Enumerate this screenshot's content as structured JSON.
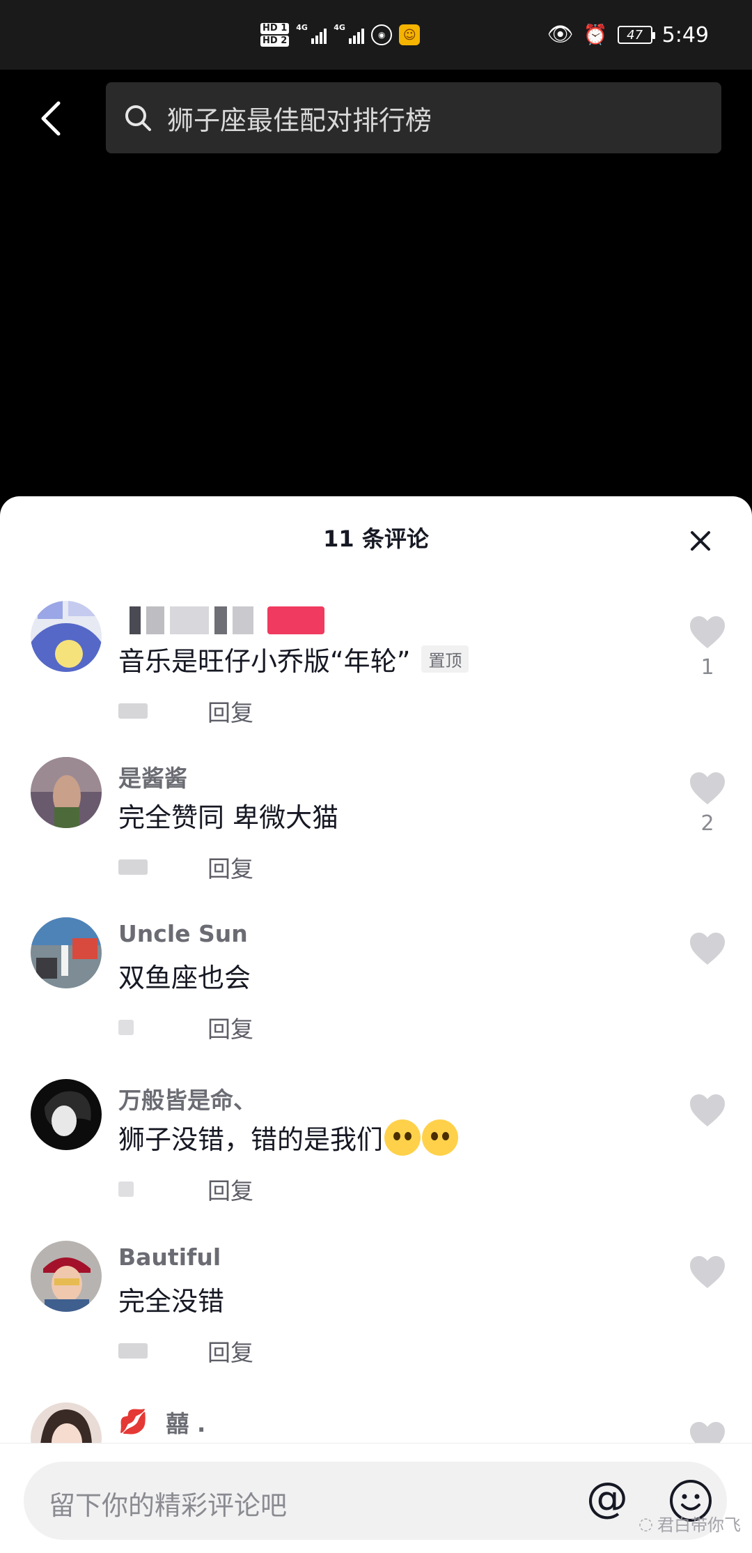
{
  "status_bar": {
    "hd1": "HD 1",
    "hd2": "HD 2",
    "net1": "4G",
    "net2": "4G",
    "battery": "47",
    "time": "5:49"
  },
  "search": {
    "query": "狮子座最佳配对排行榜"
  },
  "sheet": {
    "title": "11 条评论",
    "reply_label": "回复",
    "comments": [
      {
        "username": "",
        "text": "音乐是旺仔小乔版“年轮”",
        "pin_label": "置顶",
        "likes": "1"
      },
      {
        "username": "是酱酱",
        "text": "完全赞同 卑微大猫",
        "likes": "2"
      },
      {
        "username": "Uncle Sun",
        "text": "双鱼座也会",
        "reply_label": "回复",
        "likes": ""
      },
      {
        "username": "万般皆是命、",
        "text": "狮子没错，错的是我们",
        "reply_label": "回复",
        "likes": ""
      },
      {
        "username": "Bautiful",
        "text": "完全没错",
        "likes": ""
      },
      {
        "username": "囍 .",
        "text": "",
        "likes": ""
      }
    ]
  },
  "input": {
    "placeholder": "留下你的精彩评论吧",
    "at_symbol": "@"
  },
  "watermark": "君白带你飞",
  "icons": {
    "back": "chevron-left-icon",
    "search": "search-icon",
    "close": "close-icon",
    "like": "heart-icon",
    "emoji": "smiley-icon"
  },
  "colors": {
    "sheet_bg": "#ffffff",
    "header_bg": "#000000",
    "search_bg": "#2a2a2a",
    "like_gray": "#d2d2d6",
    "text_primary": "#161823",
    "text_secondary": "#6b6c73"
  }
}
